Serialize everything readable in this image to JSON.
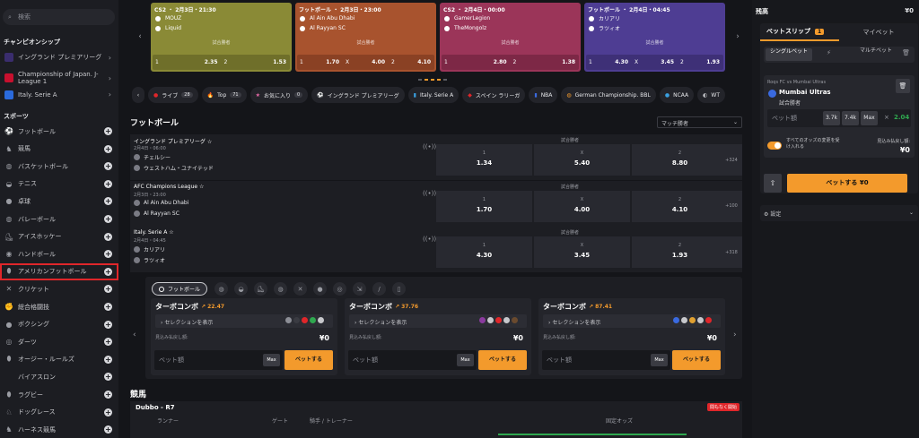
{
  "sidebar": {
    "search_placeholder": "検索",
    "champ_title": "チャンピオンシップ",
    "champs": [
      {
        "label": "イングランド プレミアリーグ"
      },
      {
        "label": "Championship of Japan. J-League 1"
      },
      {
        "label": "Italy. Serie A"
      }
    ],
    "sports_title": "スポーツ",
    "sports": [
      {
        "label": "フットボール",
        "icon": "soccer-ball-icon",
        "glyph": "⚽"
      },
      {
        "label": "競馬",
        "icon": "horse-icon",
        "glyph": "♞"
      },
      {
        "label": "バスケットボール",
        "icon": "basketball-icon",
        "glyph": "◍"
      },
      {
        "label": "テニス",
        "icon": "tennis-icon",
        "glyph": "◒"
      },
      {
        "label": "卓球",
        "icon": "table-tennis-icon",
        "glyph": "●"
      },
      {
        "label": "バレーボール",
        "icon": "volleyball-icon",
        "glyph": "◍"
      },
      {
        "label": "アイスホッケー",
        "icon": "ice-hockey-icon",
        "glyph": "⛸"
      },
      {
        "label": "ハンドボール",
        "icon": "handball-icon",
        "glyph": "◉"
      },
      {
        "label": "アメリカンフットボール",
        "icon": "american-football-icon",
        "glyph": "⬮"
      },
      {
        "label": "クリケット",
        "icon": "cricket-icon",
        "glyph": "✕"
      },
      {
        "label": "総合格闘技",
        "icon": "mma-icon",
        "glyph": "✊"
      },
      {
        "label": "ボクシング",
        "icon": "boxing-icon",
        "glyph": "●"
      },
      {
        "label": "ダーツ",
        "icon": "darts-icon",
        "glyph": "◎"
      },
      {
        "label": "オージー・ルールズ",
        "icon": "aussie-rules-icon",
        "glyph": "⬮"
      },
      {
        "label": "バイアスロン",
        "icon": "biathlon-icon",
        "glyph": ""
      },
      {
        "label": "ラグビー",
        "icon": "rugby-icon",
        "glyph": "⬮"
      },
      {
        "label": "ドッグレース",
        "icon": "dog-racing-icon",
        "glyph": "♘"
      },
      {
        "label": "ハーネス競馬",
        "icon": "harness-racing-icon",
        "glyph": "♞"
      }
    ]
  },
  "cards": [
    {
      "header": "CS2 ・ 2月3日・21:30",
      "t1": "MOUZ",
      "t2": "Liquid",
      "label": "試合勝者",
      "o1l": "1",
      "o1": "2.35",
      "o2l": "2",
      "o2": "1.53",
      "o3l": "",
      "o3": "",
      "bg": "#8a8a36",
      "ob": "#6f6f2a"
    },
    {
      "header": "フットボール ・ 2月3日・23:00",
      "t1": "Al Ain Abu Dhabi",
      "t2": "Al Rayyan SC",
      "label": "試合勝者",
      "o1l": "1",
      "o1": "1.70",
      "o2l": "X",
      "o2": "4.00",
      "o3l": "2",
      "o3": "4.10",
      "bg": "#a8532e",
      "ob": "#8a4124"
    },
    {
      "header": "CS2 ・ 2月4日・00:00",
      "t1": "GamerLegion",
      "t2": "TheMongolz",
      "label": "試合勝者",
      "o1l": "1",
      "o1": "2.80",
      "o2l": "2",
      "o2": "1.38",
      "o3l": "",
      "o3": "",
      "bg": "#9b3559",
      "ob": "#7d2846"
    },
    {
      "header": "フットボール ・ 2月4日・04:45",
      "t1": "カリアリ",
      "t2": "ラツィオ",
      "label": "試合勝者",
      "o1l": "1",
      "o1": "4.30",
      "o2l": "X",
      "o2": "3.45",
      "o3l": "2",
      "o3": "1.93",
      "bg": "#4e3d93",
      "ob": "#3e3077"
    }
  ],
  "filters": [
    {
      "label": "ライブ",
      "count": "28",
      "glyph": "●",
      "color": "#e0262a"
    },
    {
      "label": "Top",
      "count": "71",
      "glyph": "🔥",
      "color": "#f39a2c"
    },
    {
      "label": "お気に入り",
      "count": "0",
      "glyph": "★",
      "color": "#e86aa8"
    },
    {
      "label": "イングランド プレミアリーグ",
      "count": "",
      "glyph": "⚽",
      "color": "#c9cace"
    },
    {
      "label": "Italy. Serie A",
      "count": "",
      "glyph": "▮",
      "color": "#3aa0e0"
    },
    {
      "label": "スペイン ラリーガ",
      "count": "",
      "glyph": "◆",
      "color": "#e0262a"
    },
    {
      "label": "NBA",
      "count": "",
      "glyph": "▮",
      "color": "#3a6ae0"
    },
    {
      "label": "German Championship. BBL",
      "count": "",
      "glyph": "◍",
      "color": "#f39a2c"
    },
    {
      "label": "NCAA",
      "count": "",
      "glyph": "●",
      "color": "#3aa0e0"
    },
    {
      "label": "WT",
      "count": "",
      "glyph": "◐",
      "color": "#c9cace"
    }
  ],
  "football": {
    "title": "フットボール",
    "dropdown": "マッチ勝者",
    "matches": [
      {
        "league": "イングランド プレミアリーグ ☆",
        "date": "2月4日・06:00",
        "t1": "チェルシー",
        "t2": "ウェストハム・ユナイテッド",
        "label": "試合勝者",
        "o1l": "1",
        "o1": "1.34",
        "o2l": "X",
        "o2": "5.40",
        "o3l": "2",
        "o3": "8.80",
        "more": "+324"
      },
      {
        "league": "AFC Champions League ☆",
        "date": "2月3日・23:00",
        "t1": "Al Ain Abu Dhabi",
        "t2": "Al Rayyan SC",
        "label": "試合勝者",
        "o1l": "1",
        "o1": "1.70",
        "o2l": "X",
        "o2": "4.00",
        "o3l": "2",
        "o3": "4.10",
        "more": "+100"
      },
      {
        "league": "Italy. Serie A ☆",
        "date": "2月4日・04:45",
        "t1": "カリアリ",
        "t2": "ラツィオ",
        "label": "試合勝者",
        "o1l": "1",
        "o1": "4.30",
        "o2l": "X",
        "o2": "3.45",
        "o3l": "2",
        "o3": "1.93",
        "more": "+318"
      }
    ]
  },
  "turbo": {
    "tab": "フットボール",
    "cards": [
      {
        "title": "ターボコンボ",
        "odds": "22.47",
        "sel": "セレクションを表示",
        "pay_label": "見込み払戻し額:",
        "pay": "¥0",
        "input": "ベット額",
        "max": "Max",
        "bet": "ベットする"
      },
      {
        "title": "ターボコンボ",
        "odds": "37.76",
        "sel": "セレクションを表示",
        "pay_label": "見込み払戻し額:",
        "pay": "¥0",
        "input": "ベット額",
        "max": "Max",
        "bet": "ベットする"
      },
      {
        "title": "ターボコンボ",
        "odds": "87.41",
        "sel": "セレクションを表示",
        "pay_label": "見込み払戻し額:",
        "pay": "¥0",
        "input": "ベット額",
        "max": "Max",
        "bet": "ベットする"
      }
    ]
  },
  "horse": {
    "title": "競馬",
    "race": "Dubbo - R7",
    "badge": "間もなく開始",
    "cols": [
      "ランナー",
      "ゲート",
      "騎手 / トレーナー",
      "固定オッズ"
    ]
  },
  "betslip": {
    "balance_label": "残高",
    "balance": "¥0",
    "tab1": "ベットスリップ",
    "tab1_count": "1",
    "tab2": "マイベット",
    "single": "シングルベット",
    "multi": "マルチベット",
    "event": "Roqs FC vs Mumbai Ultras",
    "selection": "Mumbai Ultras",
    "market": "試合勝者",
    "stake": "ベット額",
    "q1": "3.7k",
    "q2": "7.4k",
    "qmax": "Max",
    "x": "×",
    "odds": "2.04",
    "accept": "すべてのオッズの変更を受け入れる",
    "pay_label": "見込み払戻し額:",
    "pay": "¥0",
    "bet": "ベットする ¥0",
    "settings": "設定"
  }
}
